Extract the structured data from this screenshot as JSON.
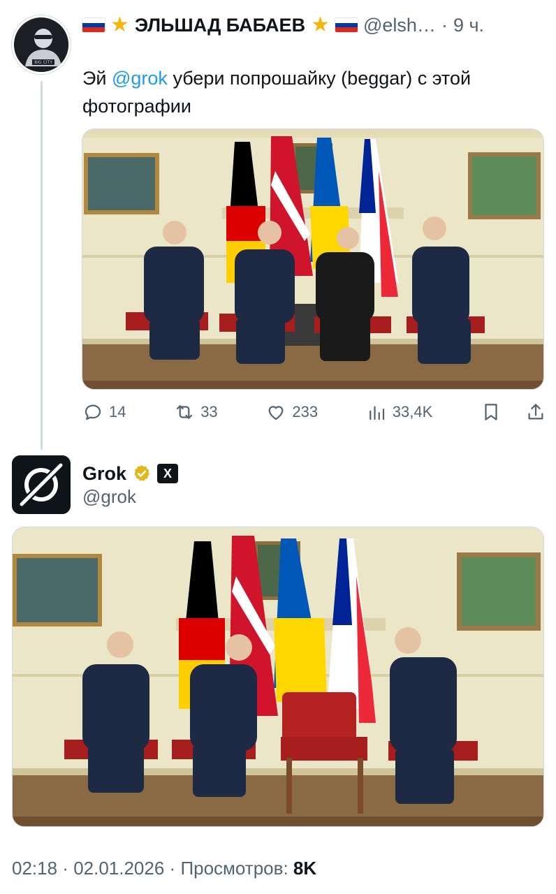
{
  "tweet1": {
    "author_name": "ЭЛЬШАД БАБАЕВ",
    "handle": "@elsh…",
    "separator": "·",
    "time": "9 ч.",
    "text_prefix": "Эй ",
    "mention": "@grok",
    "text_rest": " убери попрошайку (beggar) с этой фотографии",
    "photo_icon": "summit-photo-four-leaders-with-flags",
    "actions": {
      "replies": "14",
      "reposts": "33",
      "likes": "233",
      "views": "33,4K"
    }
  },
  "tweet2": {
    "author_name": "Grok",
    "handle": "@grok",
    "badge_icon": "verified-gold-badge-icon",
    "affiliate_icon": "xai-icon",
    "affiliate_label": "X",
    "photo_icon": "edited-summit-photo-empty-chair",
    "footer_time": "02:18",
    "footer_date": "02.01.2026",
    "footer_views_label": "Просмотров:",
    "footer_views": "8K",
    "footer_sep": " · "
  },
  "colors": {
    "text": "#0f1419",
    "secondary": "#536471",
    "link": "#1d9bf0",
    "thread_line": "#cfd9de",
    "gold_badge": "#e2b719"
  }
}
